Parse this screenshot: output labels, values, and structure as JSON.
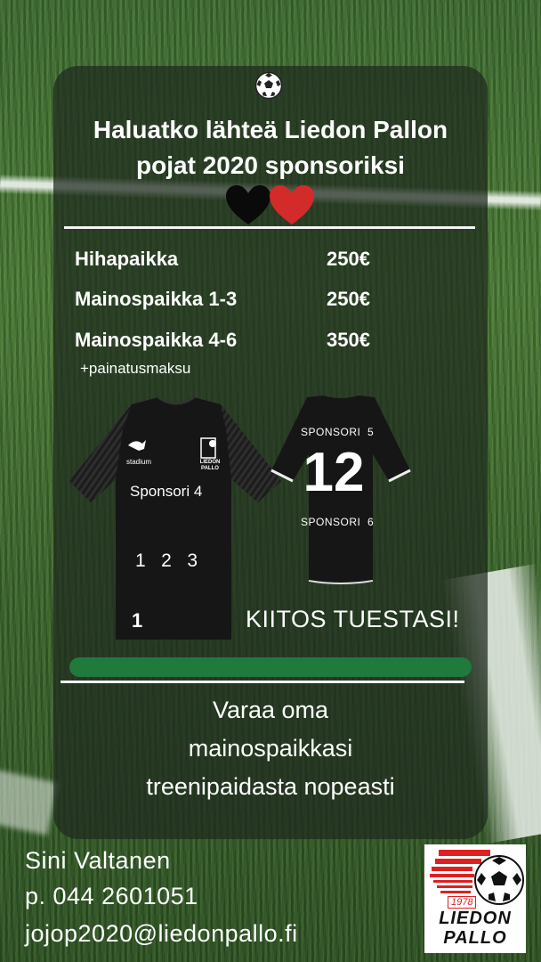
{
  "poster": {
    "title_line1": "Haluatko lähteä Liedon Pallon",
    "title_line2": "pojat 2020 sponsoriksi",
    "icons": [
      "soccer-ball-icon",
      "black-heart-icon",
      "red-heart-icon"
    ],
    "prices": [
      {
        "label": "Hihapaikka",
        "amount": "250€"
      },
      {
        "label": "Mainospaikka 1-3",
        "amount": "250€"
      },
      {
        "label": "Mainospaikka 4-6",
        "amount": "350€"
      }
    ],
    "note": "+painatusmaksu",
    "shirt_front": {
      "sponsor4": "Sponsori 4",
      "slots": "1   2   3",
      "sleeve": "1",
      "brand": "stadium",
      "club_badge": "LIEDON PALLO"
    },
    "shirt_back": {
      "sponsor5": "SPONSORI  5",
      "number": "12",
      "sponsor6": "SPONSORI  6"
    },
    "thanks": "KIITOS TUESTASI!",
    "cta_line1": "Varaa oma",
    "cta_line2": "mainospaikkasi",
    "cta_line3": "treenipaidasta nopeasti"
  },
  "contact": {
    "name": "Sini Valtanen",
    "phone": "p. 044 2601051",
    "email": "jojop2020@liedonpallo.fi"
  },
  "logo": {
    "year": "1978",
    "line1": "LIEDON",
    "line2": "PALLO"
  },
  "colors": {
    "panel": "#1e2a1e",
    "accent_green": "#1f7a3c",
    "heart_red": "#d32a2a",
    "logo_red": "#e02020"
  }
}
